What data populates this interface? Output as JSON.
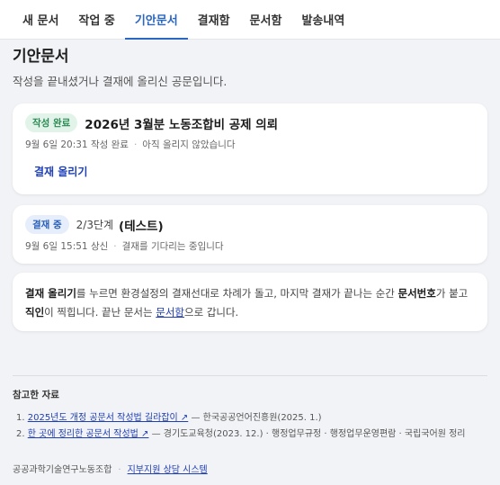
{
  "tabs": [
    {
      "label": "새 문서",
      "active": false
    },
    {
      "label": "작업 중",
      "active": false
    },
    {
      "label": "기안문서",
      "active": true
    },
    {
      "label": "결재함",
      "active": false
    },
    {
      "label": "문서함",
      "active": false
    },
    {
      "label": "발송내역",
      "active": false
    }
  ],
  "page": {
    "title": "기안문서",
    "subtitle": "작성을 끝내셨거나 결재에 올리신 공문입니다."
  },
  "documents": [
    {
      "badge": "작성 완료",
      "title": "2026년 3월분 노동조합비 공제 의뢰",
      "date": "9월 6일 20:31 작성 완료",
      "status": "아직 올리지 않았습니다",
      "action": "결재 올리기"
    },
    {
      "badge": "결재 중",
      "step": "2/3단계",
      "title": "(테스트)",
      "date": "9월 6일 15:51 상신",
      "status": "결재를 기다리는 중입니다"
    }
  ],
  "notice": {
    "b1": "결재 올리기",
    "t1": "를 누르면 환경설정의 결재선대로 차례가 돌고, 마지막 결재가 끝나는 순간 ",
    "b2": "문서번호",
    "t2": "가 붙고 ",
    "b3": "직인",
    "t3": "이 찍힙니다. 끝난 문서는 ",
    "link": "문서함",
    "t4": "으로 갑니다."
  },
  "references": {
    "title": "참고한 자료",
    "items": [
      {
        "num": "1.",
        "link": "2025년도 개정 공문서 작성법 길라잡이 ↗",
        "rest": " — 한국공공언어진흥원(2025. 1.)"
      },
      {
        "num": "2.",
        "link": "한 곳에 정리한 공문서 작성법 ↗",
        "rest": " — 경기도교육청(2023. 12.) · 행정업무규정 · 행정업무운영편람 · 국립국어원 정리"
      }
    ]
  },
  "footer": {
    "org": "공공과학기술연구노동조합",
    "link": "지부지원 상담 시스템"
  },
  "colors": {
    "accent": "#2a66c2",
    "link": "#1f3fb5",
    "badge_done_bg": "#e2f4ea",
    "badge_done_fg": "#2c8a52",
    "badge_prog_bg": "#e6eefb",
    "badge_prog_fg": "#2a5fb8"
  }
}
